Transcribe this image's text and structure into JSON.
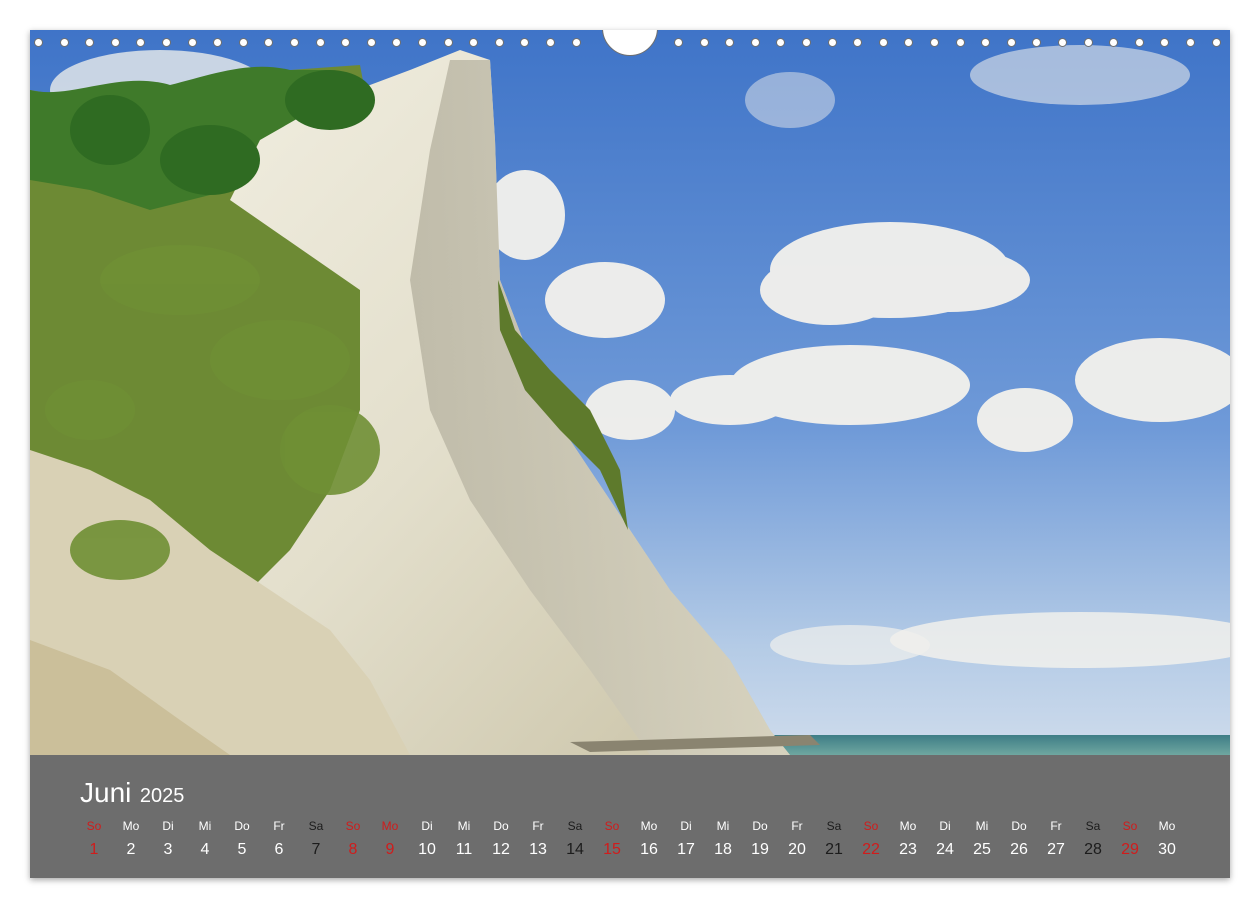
{
  "calendar": {
    "month": "Juni",
    "year": "2025",
    "days": [
      {
        "wd": "So",
        "d": "1",
        "type": "sunday"
      },
      {
        "wd": "Mo",
        "d": "2",
        "type": "weekday"
      },
      {
        "wd": "Di",
        "d": "3",
        "type": "weekday"
      },
      {
        "wd": "Mi",
        "d": "4",
        "type": "weekday"
      },
      {
        "wd": "Do",
        "d": "5",
        "type": "weekday"
      },
      {
        "wd": "Fr",
        "d": "6",
        "type": "weekday"
      },
      {
        "wd": "Sa",
        "d": "7",
        "type": "saturday"
      },
      {
        "wd": "So",
        "d": "8",
        "type": "sunday"
      },
      {
        "wd": "Mo",
        "d": "9",
        "type": "holiday"
      },
      {
        "wd": "Di",
        "d": "10",
        "type": "weekday"
      },
      {
        "wd": "Mi",
        "d": "11",
        "type": "weekday"
      },
      {
        "wd": "Do",
        "d": "12",
        "type": "weekday"
      },
      {
        "wd": "Fr",
        "d": "13",
        "type": "weekday"
      },
      {
        "wd": "Sa",
        "d": "14",
        "type": "saturday"
      },
      {
        "wd": "So",
        "d": "15",
        "type": "sunday"
      },
      {
        "wd": "Mo",
        "d": "16",
        "type": "weekday"
      },
      {
        "wd": "Di",
        "d": "17",
        "type": "weekday"
      },
      {
        "wd": "Mi",
        "d": "18",
        "type": "weekday"
      },
      {
        "wd": "Do",
        "d": "19",
        "type": "weekday"
      },
      {
        "wd": "Fr",
        "d": "20",
        "type": "weekday"
      },
      {
        "wd": "Sa",
        "d": "21",
        "type": "saturday"
      },
      {
        "wd": "So",
        "d": "22",
        "type": "sunday"
      },
      {
        "wd": "Mo",
        "d": "23",
        "type": "weekday"
      },
      {
        "wd": "Di",
        "d": "24",
        "type": "weekday"
      },
      {
        "wd": "Mi",
        "d": "25",
        "type": "weekday"
      },
      {
        "wd": "Do",
        "d": "26",
        "type": "weekday"
      },
      {
        "wd": "Fr",
        "d": "27",
        "type": "weekday"
      },
      {
        "wd": "Sa",
        "d": "28",
        "type": "saturday"
      },
      {
        "wd": "So",
        "d": "29",
        "type": "sunday"
      },
      {
        "wd": "Mo",
        "d": "30",
        "type": "weekday"
      }
    ]
  },
  "colors": {
    "bar": "#6d6d6d",
    "text": "#ffffff",
    "saturday": "#1c1c1c",
    "sunday_holiday": "#d01c1c"
  }
}
